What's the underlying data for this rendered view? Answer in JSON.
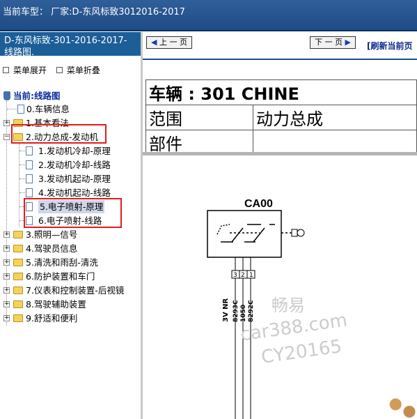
{
  "window": {
    "title": "当前车型：  厂家:D-东风标致3012016-2017"
  },
  "sidebar": {
    "header": "D-东风标致-301-2016-2017- 线路图.",
    "expand_label": "菜单展开",
    "collapse_label": "菜单折叠",
    "root_label": "当前:线路图",
    "items": [
      {
        "label": "0.车辆信息"
      },
      {
        "label": "1.基本看法"
      },
      {
        "label": "2.动力总成-发动机"
      },
      {
        "label": "1.发动机冷却-原理"
      },
      {
        "label": "2.发动机冷却-线路"
      },
      {
        "label": "3.发动机起动-原理"
      },
      {
        "label": "4.发动机起动-线路"
      },
      {
        "label": "5.电子喷射-原理"
      },
      {
        "label": "6.电子喷射-线路"
      },
      {
        "label": "3.照明—信号"
      },
      {
        "label": "4.驾驶员信息"
      },
      {
        "label": "5.清洗和雨刮-清洗"
      },
      {
        "label": "6.防护装置和车门"
      },
      {
        "label": "7.仪表和控制装置-后视镜"
      },
      {
        "label": "8.驾驶辅助装置"
      },
      {
        "label": "9.舒适和便利"
      }
    ]
  },
  "main": {
    "prev_label": "上 一 页",
    "next_label": "下 一 页",
    "refresh_label": "[刷新当前页",
    "vehicle_row": "车辆 : 301 CHINE",
    "scope_label": "范围",
    "scope_value": "动力总成",
    "part_label": "部件",
    "part_value": "",
    "diagram": {
      "component": "CA00",
      "pins": [
        "3",
        "2",
        "1"
      ],
      "wires": [
        "3V NR",
        "8293C",
        "1050",
        "8292C"
      ]
    }
  },
  "watermark": {
    "line1": "畅易",
    "line2": "car388.com",
    "line3": "CY20165"
  },
  "colors": {
    "title_bar": "#2f5f99",
    "sidebar_header": "#1c5e98",
    "highlight_box": "#e41b1b",
    "selected_bg": "#cfd6e8"
  }
}
